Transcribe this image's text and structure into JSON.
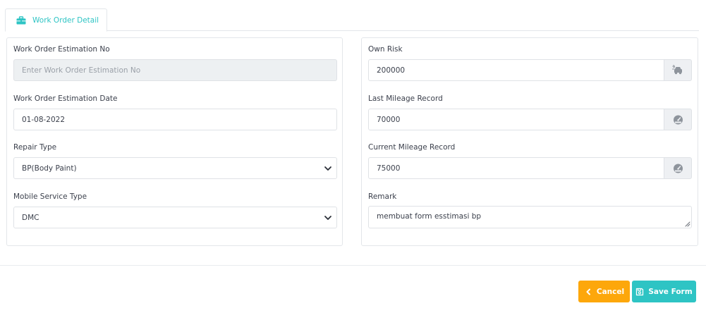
{
  "tabs": [
    {
      "label": "Work Order Detail",
      "icon": "briefcase-icon",
      "active": true
    }
  ],
  "left": {
    "estimation_no": {
      "label": "Work Order Estimation No",
      "value": "",
      "placeholder": "Enter Work Order Estimation No",
      "disabled": true
    },
    "estimation_date": {
      "label": "Work Order Estimation Date",
      "value": "01-08-2022"
    },
    "repair_type": {
      "label": "Repair Type",
      "selected": "BP(Body Paint)"
    },
    "mobile_service_type": {
      "label": "Mobile Service Type",
      "selected": "DMC"
    }
  },
  "right": {
    "own_risk": {
      "label": "Own Risk",
      "value": "200000",
      "addon_icon": "car-crash-icon"
    },
    "last_mileage": {
      "label": "Last Mileage Record",
      "value": "70000",
      "addon_icon": "speedometer-icon"
    },
    "current_mileage": {
      "label": "Current Mileage Record",
      "value": "75000",
      "addon_icon": "speedometer-icon"
    },
    "remark": {
      "label": "Remark",
      "value": "membuat form esstimasi bp"
    }
  },
  "footer": {
    "cancel_label": "Cancel",
    "save_label": "Save Form"
  },
  "colors": {
    "accent": "#2ec4c4",
    "cancel": "#fda70b",
    "disabled_bg": "#edf0f2",
    "addon_bg": "#eef0f3"
  }
}
